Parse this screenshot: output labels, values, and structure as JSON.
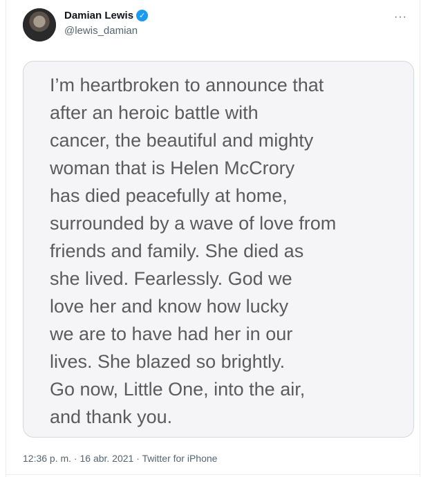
{
  "author": {
    "name": "Damian Lewis",
    "handle": "@lewis_damian",
    "verified_symbol": "✓"
  },
  "more_label": "···",
  "media_text_lines": [
    "I’m heartbroken to announce that",
    "after an heroic battle with",
    "cancer, the beautiful and mighty",
    "woman that is Helen McCrory",
    "has died peacefully at home,",
    "surrounded by a wave of love from",
    "friends and family. She died as",
    "she lived. Fearlessly. God we",
    "love her and know how lucky",
    "we are to have had her in our",
    "lives. She blazed so brightly.",
    "Go now, Little One, into the air,",
    "and thank you."
  ],
  "timestamp": "12:36 p. m. · 16 abr. 2021 · Twitter for iPhone"
}
